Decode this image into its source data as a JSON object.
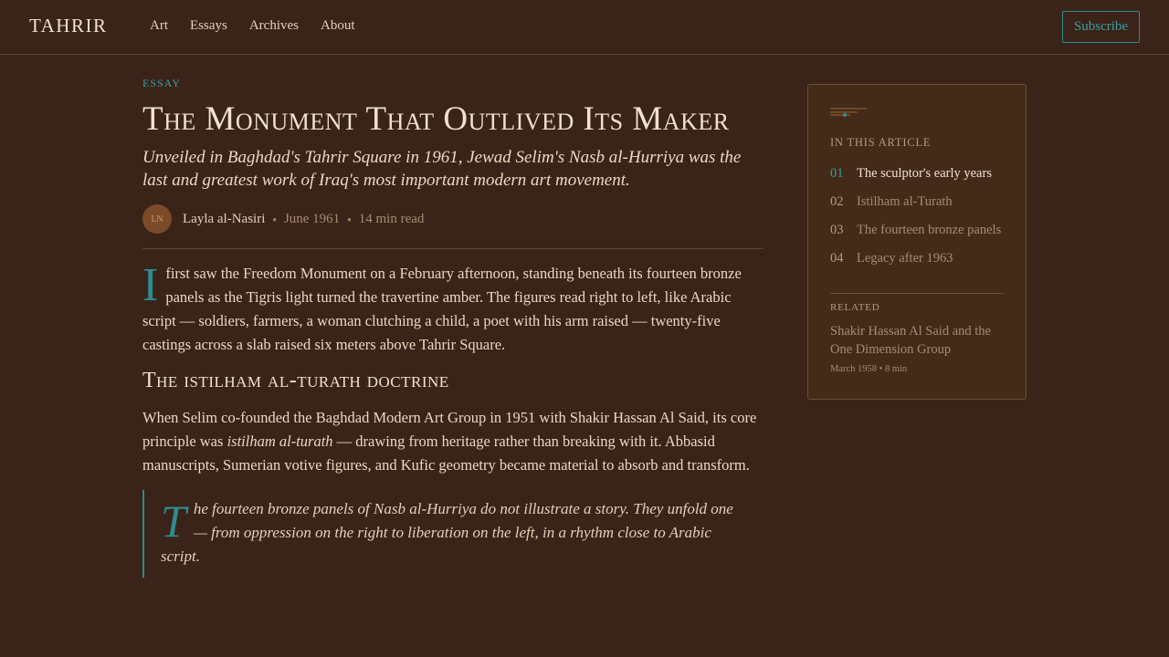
{
  "header": {
    "brand": "TAHRIR",
    "nav": [
      "Art",
      "Essays",
      "Archives",
      "About"
    ],
    "subscribe_label": "Subscribe"
  },
  "article": {
    "kicker": "ESSAY",
    "title": "The Monument That Outlived Its Maker",
    "dek": "Unveiled in Baghdad's Tahrir Square in 1961, Jewad Selim's Nasb al-Hurriya was the last and greatest work of Iraq's most important modern art movement.",
    "byline": {
      "initials": "LN",
      "author": "Layla al-Nasiri",
      "date": "June 1961",
      "read_time": "14 min read"
    },
    "lead": {
      "dropcap": "I",
      "text": "first saw the Freedom Monument on a February afternoon, standing beneath its fourteen bronze panels as the Tigris light turned the travertine amber. The figures read right to left, like Arabic script — soldiers, farmers, a woman clutching a child, a poet with his arm raised — twenty-five castings across a slab raised six meters above Tahrir Square."
    },
    "section_heading": "The istilham al-turath doctrine",
    "para2": {
      "before": "When Selim co-founded the Baghdad Modern Art Group in 1951 with Shakir Hassan Al Said, its core principle was ",
      "emphasis": "istilham al-turath",
      "after": " — drawing from heritage rather than breaking with it. Abbasid manuscripts, Sumerian votive figures, and Kufic geometry became material to absorb and transform."
    },
    "quote": {
      "dropcap": "T",
      "text": "he fourteen bronze panels of Nasb al-Hurriya do not illustrate a story. They unfold one — from oppression on the right to liberation on the left, in a rhythm close to Arabic script."
    }
  },
  "sidebar": {
    "heading": "IN THIS ARTICLE",
    "toc": [
      {
        "num": "01",
        "label": "The sculptor's early years",
        "active": true
      },
      {
        "num": "02",
        "label": "Istilham al-Turath",
        "active": false
      },
      {
        "num": "03",
        "label": "The fourteen bronze panels",
        "active": false
      },
      {
        "num": "04",
        "label": "Legacy after 1963",
        "active": false
      }
    ],
    "related_label": "RELATED",
    "related_title": "Shakir Hassan Al Said and the One Dimension Group",
    "related_meta": "March 1958 • 8 min"
  },
  "colors": {
    "background": "#3a2318",
    "accent": "#2f8b8f",
    "sidebar_bg": "#442a18"
  }
}
